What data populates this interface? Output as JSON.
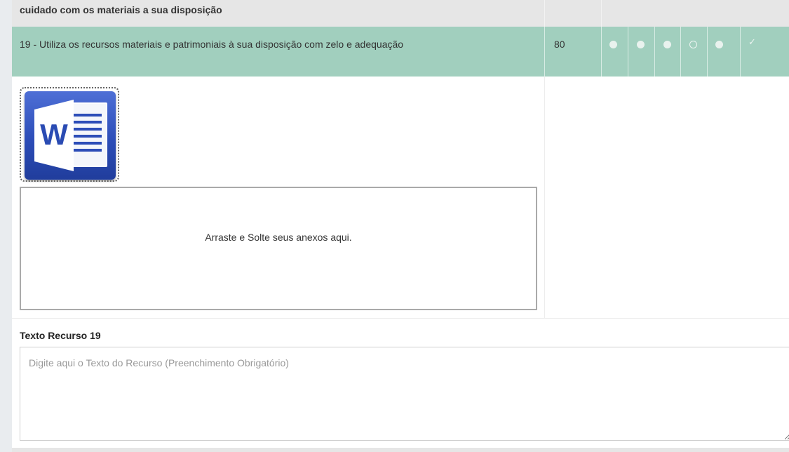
{
  "section": {
    "title": "cuidado com os materiais a sua disposição"
  },
  "item": {
    "description": "19 - Utiliza os recursos materiais e patrimoniais à sua disposição com zelo e adequação",
    "score": "80",
    "options": [
      {
        "state": "filled"
      },
      {
        "state": "filled"
      },
      {
        "state": "filled"
      },
      {
        "state": "empty"
      },
      {
        "state": "filled"
      }
    ],
    "check_mark": "✓"
  },
  "attachment": {
    "icon": "word-document-icon",
    "icon_letter": "W",
    "dropzone_text": "Arraste e Solte seus anexos aqui."
  },
  "recurso": {
    "label": "Texto Recurso 19",
    "value": "",
    "placeholder": "Digite aqui o Texto do Recurso (Preenchimento Obrigatório)"
  },
  "colors": {
    "row_highlight": "#a1cfbe",
    "header_bg": "#e6e6e6",
    "word_blue": "#2c4db8"
  }
}
